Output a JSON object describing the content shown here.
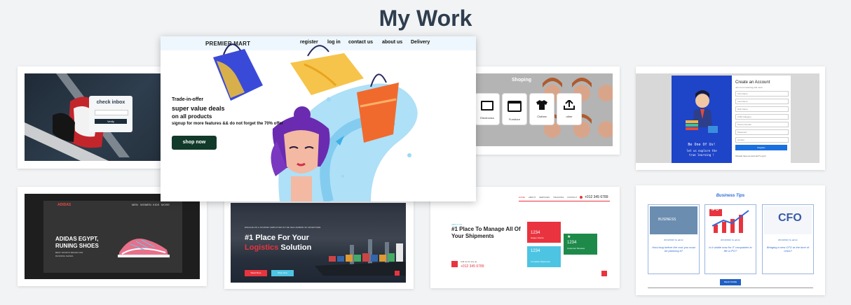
{
  "page_title": "My Work",
  "featured": {
    "brand": "PREMIER MART",
    "nav": [
      "register",
      "log in",
      "contact us",
      "about us",
      "Delivery"
    ],
    "tagline": "Trade-in-offer",
    "headline1": "super value deals",
    "headline2": "on all products",
    "subline": "signup for more features && do not forget the 70% offer",
    "button": "shop now"
  },
  "card_check_inbox": {
    "heading": "check inbox",
    "button": "Verify"
  },
  "card_shopping": {
    "title": "Shoping",
    "items": [
      "Electronics",
      "Furniture",
      "Clothes",
      "other"
    ]
  },
  "card_account": {
    "title": "Create an Account",
    "subtitle": "Join us for learning and more",
    "fields": [
      "First Name",
      "Last Name",
      "Nick Name",
      "Child Category",
      "Phone Number",
      "Password",
      "Gender"
    ],
    "button": "Register",
    "footer": "Already have an account? Log In",
    "tagline1": "Be One Of Us!",
    "tagline2": "let us explore the",
    "tagline3": "true learning !"
  },
  "card_adidas": {
    "logo": "ADIDAS",
    "nav": [
      "MEN",
      "WOMEN",
      "KIDS",
      "MORE"
    ],
    "headline1": "ADIDAS EGYPT,",
    "headline2": "RUNING SHOES",
    "sub1": "BEST SPORTS BRAND FOR",
    "sub2": "RUNNING SHOES"
  },
  "card_logistics": {
    "eyebrow": "ENGAGE ON A JOURNEY EMPLOYED IN THE SEA HARBOR OF ADVENTURE",
    "headline1": "#1 Place For Your",
    "headline2_accent": "Logistics",
    "headline2_rest": " Solution",
    "btn1": "Read More",
    "btn2": "Shop Now"
  },
  "card_shipments": {
    "nav": [
      "HOME",
      "ABOUT",
      "SERVICES",
      "TRACKING",
      "CONTACT"
    ],
    "phone": "+012 345 6789",
    "eyebrow": "ABOUT US",
    "headline1": "#1 Place To Manage All Of",
    "headline2": "Your Shipments",
    "call_label": "Call us for any qs",
    "call_number": "+012 345 6789",
    "stats": [
      {
        "value": "1234",
        "label": "Happy Clients",
        "color": "#e9343f"
      },
      {
        "value": "1234",
        "label": "Complete Shipments",
        "color": "#4ec4e3"
      },
      {
        "value": "1234",
        "label": "Customer Reviews",
        "color": "#1e8a4a"
      }
    ]
  },
  "card_business": {
    "title": "Business Tips",
    "posts": [
      {
        "date": "20/10/2022 by admin",
        "caption": "How long before the cost you must be planning it?"
      },
      {
        "date": "20/10/2022 by admin",
        "caption": "Is it viable now for IT companies to file a IPO?"
      },
      {
        "date": "20/10/2022 by admin",
        "caption": "Bringing a new CFO at the time of crisis?"
      }
    ],
    "button": "READ MORE",
    "image_labels": [
      "BUSINESS",
      "IPO",
      "CFO"
    ]
  }
}
